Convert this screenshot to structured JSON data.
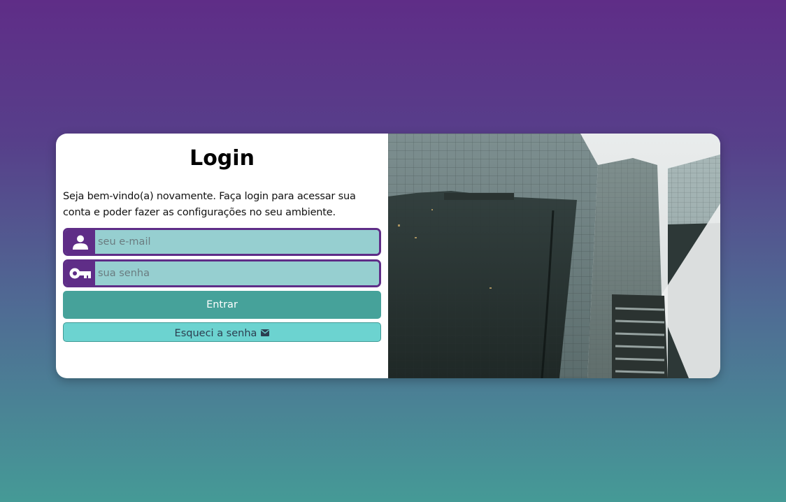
{
  "login": {
    "title": "Login",
    "welcome": "Seja bem-vindo(a) novamente. Faça login para acessar sua conta e poder fazer as configurações no seu ambiente.",
    "email_placeholder": "seu e-mail",
    "password_placeholder": "sua senha",
    "submit_label": "Entrar",
    "forgot_label": "Esqueci a senha"
  },
  "icons": {
    "email_field": "user-icon",
    "password_field": "key-icon",
    "forgot_button": "envelope-icon"
  },
  "colors": {
    "primary_purple": "#5f2d87",
    "input_bg": "#96cfd0",
    "submit_button": "#46a29a",
    "forgot_button": "#6cd3d0"
  }
}
